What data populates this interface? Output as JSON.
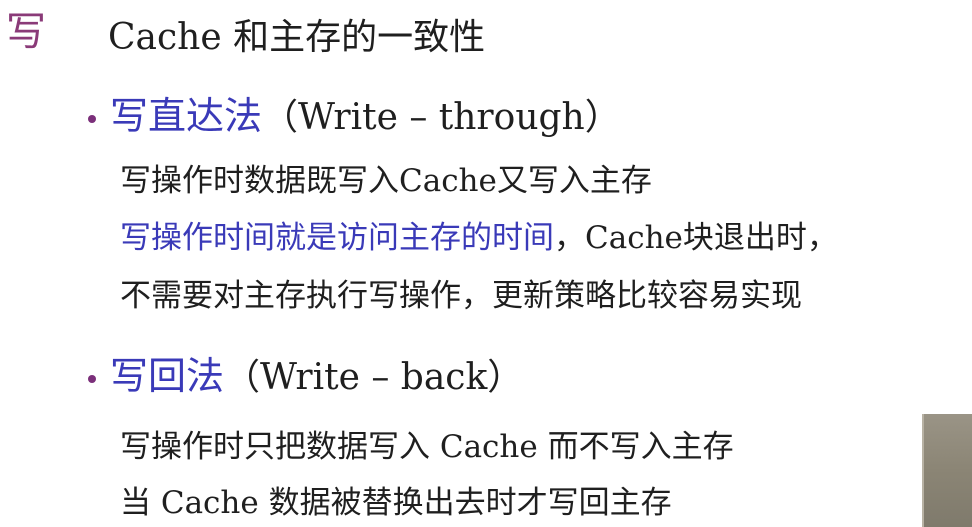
{
  "header": {
    "section_char": "写",
    "title": "Cache 和主存的一致性"
  },
  "bullets": [
    {
      "heading_cn": "写直达法",
      "heading_en": "（Write – through）",
      "lines": [
        {
          "segments": [
            {
              "text": "写操作时数据既写入Cache又写入主存",
              "highlight": false
            }
          ]
        },
        {
          "segments": [
            {
              "text": "写操作时间就是访问主存的时间",
              "highlight": true
            },
            {
              "text": "，Cache块退出时，",
              "highlight": false
            }
          ]
        },
        {
          "segments": [
            {
              "text": "不需要对主存执行写操作，更新策略比较容易实现",
              "highlight": false
            }
          ]
        }
      ]
    },
    {
      "heading_cn": "写回法",
      "heading_en": "（Write – back）",
      "lines": [
        {
          "segments": [
            {
              "text": "写操作时只把数据写入 Cache 而不写入主存",
              "highlight": false
            }
          ]
        },
        {
          "segments": [
            {
              "text": "当 Cache 数据被替换出去时才写回主存",
              "highlight": false
            }
          ]
        }
      ]
    }
  ],
  "colors": {
    "accent_purple": "#8a3a78",
    "bullet_dot": "#7b2f7a",
    "highlight_blue": "#3a3ab8",
    "body_text": "#1f1f1f",
    "background": "#ffffff"
  }
}
